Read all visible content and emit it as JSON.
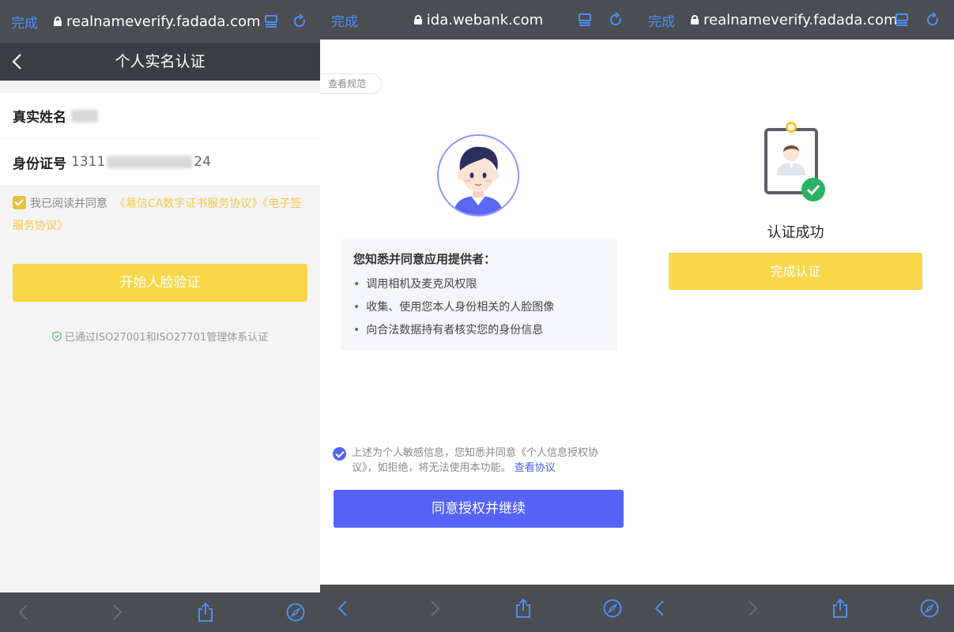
{
  "panel1": {
    "topbar": {
      "done_label": "完成",
      "url": "realnameverify.fadada.com"
    },
    "nav": {
      "title": "个人实名认证"
    },
    "form": {
      "name_label": "真实姓名",
      "id_label": "身份证号",
      "id_value_start": "1311",
      "id_value_end": "24"
    },
    "agreement": {
      "prefix": "我已阅读并同意",
      "link1": "《易信CA数字证书服务协议》",
      "link2": "《电子签服务协议》"
    },
    "start_button": "开始人脸验证",
    "certification": "已通过ISO27001和ISO27701管理体系认证"
  },
  "panel2": {
    "topbar": {
      "done_label": "完成",
      "url": "ida.webank.com"
    },
    "spec_button": "查看规范",
    "info": {
      "title": "您知悉并同意应用提供者：",
      "items": [
        "调用相机及麦克风权限",
        "收集、使用您本人身份相关的人脸图像",
        "向合法数据持有者核实您的身份信息"
      ]
    },
    "consent": {
      "text": "上述为个人敏感信息，您知悉并同意《个人信息授权协议》，如拒绝，将无法使用本功能。",
      "link": "查看协议"
    },
    "agree_button": "同意授权并继续"
  },
  "panel3": {
    "topbar": {
      "done_label": "完成",
      "url": "realnameverify.fadada.com"
    },
    "success_text": "认证成功",
    "finish_button": "完成认证"
  },
  "colors": {
    "accent_blue": "#4d8ef2",
    "yellow": "#f7d748",
    "purple": "#5562f8",
    "success_green": "#28b463"
  }
}
